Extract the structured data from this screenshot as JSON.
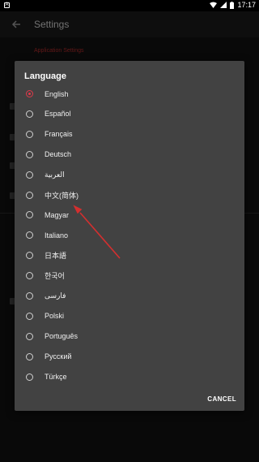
{
  "status_bar": {
    "time": "17:17"
  },
  "background": {
    "title": "Settings",
    "section_header": "Application Settings"
  },
  "dialog": {
    "title": "Language",
    "options": [
      {
        "label": "English",
        "checked": true
      },
      {
        "label": "Español",
        "checked": false
      },
      {
        "label": "Français",
        "checked": false
      },
      {
        "label": "Deutsch",
        "checked": false
      },
      {
        "label": "العربية",
        "checked": false
      },
      {
        "label": "中文(简体)",
        "checked": false
      },
      {
        "label": "Magyar",
        "checked": false
      },
      {
        "label": "Italiano",
        "checked": false
      },
      {
        "label": "日本語",
        "checked": false
      },
      {
        "label": "한국어",
        "checked": false
      },
      {
        "label": "فارسی",
        "checked": false
      },
      {
        "label": "Polski",
        "checked": false
      },
      {
        "label": "Português",
        "checked": false
      },
      {
        "label": "Русский",
        "checked": false
      },
      {
        "label": "Türkçe",
        "checked": false
      }
    ],
    "cancel_label": "CANCEL"
  },
  "colors": {
    "accent": "#e0394a",
    "dialog_bg": "#424242",
    "annotation_arrow": "#d32f2f"
  }
}
